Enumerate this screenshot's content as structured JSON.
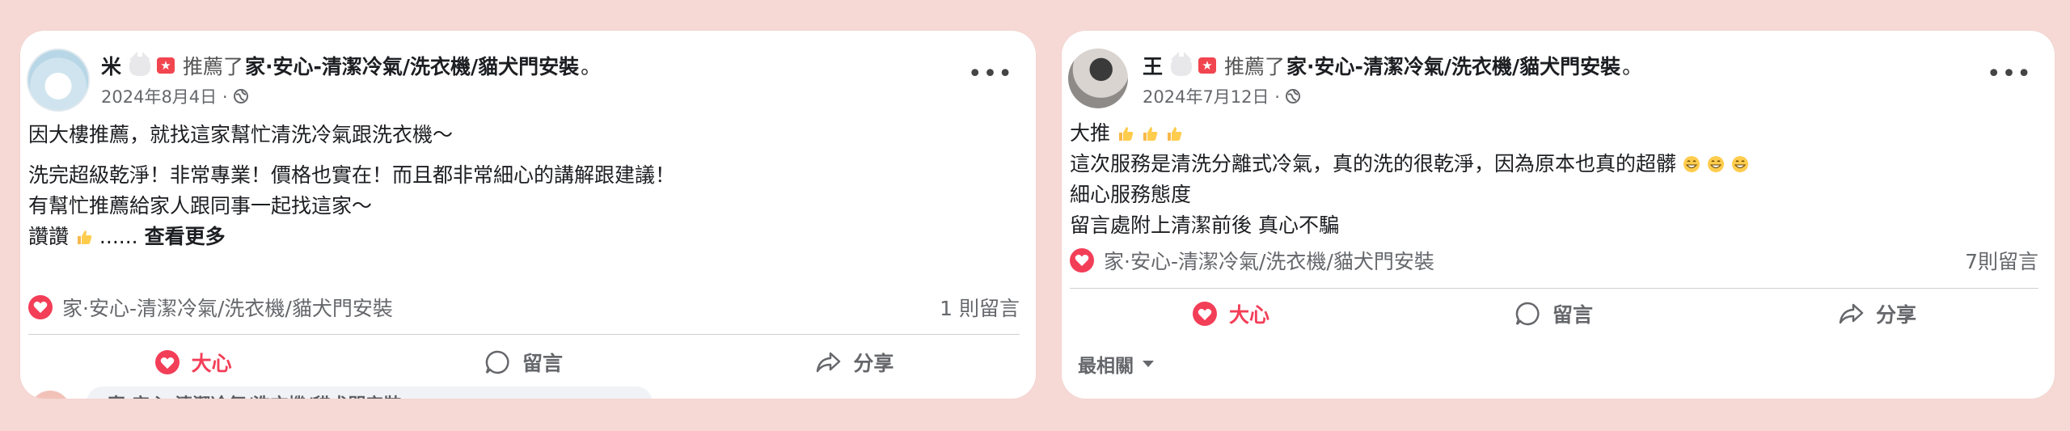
{
  "posts": [
    {
      "author": "米",
      "recommend_text": "推薦了",
      "page_name": "家·安心-清潔冷氣/洗衣機/貓犬門安裝",
      "period": "。",
      "date": "2024年8月4日 ·",
      "lines": [
        "因大樓推薦，就找這家幫忙清洗冷氣跟洗衣機～",
        "洗完超級乾淨！非常專業！價格也實在！而且都非常細心的講解跟建議！",
        "有幫忙推薦給家人跟同事一起找這家～",
        "讚讚",
        "...... "
      ],
      "see_more": "查看更多",
      "reaction_page": "家·安心-清潔冷氣/洗衣機/貓犬門安裝",
      "comment_count": "1 則留言",
      "actions": {
        "love": "大心",
        "comment": "留言",
        "share": "分享"
      },
      "comment_peek": "家·安心-清潔冷氣/洗衣機/貓犬門安裝"
    },
    {
      "author": "王",
      "recommend_text": "推薦了",
      "page_name": "家·安心-清潔冷氣/洗衣機/貓犬門安裝",
      "period": "。",
      "date": "2024年7月12日 ·",
      "lines": [
        "大推",
        "這次服務是清洗分離式冷氣，真的洗的很乾淨，因為原本也真的超髒",
        "細心服務態度",
        "留言處附上清潔前後 真心不騙"
      ],
      "reaction_page": "家·安心-清潔冷氣/洗衣機/貓犬門安裝",
      "comment_count": "7則留言",
      "actions": {
        "love": "大心",
        "comment": "留言",
        "share": "分享"
      },
      "most_relevant": "最相關"
    }
  ],
  "colors": {
    "love": "#f33e58",
    "background": "#f6d9d5",
    "badge": "#f1454f"
  },
  "icons": [
    "globe-icon",
    "more-options-icon",
    "heart-icon",
    "comment-icon",
    "share-icon",
    "thumbs-up-emoji",
    "grin-emoji",
    "chevron-down-icon"
  ]
}
